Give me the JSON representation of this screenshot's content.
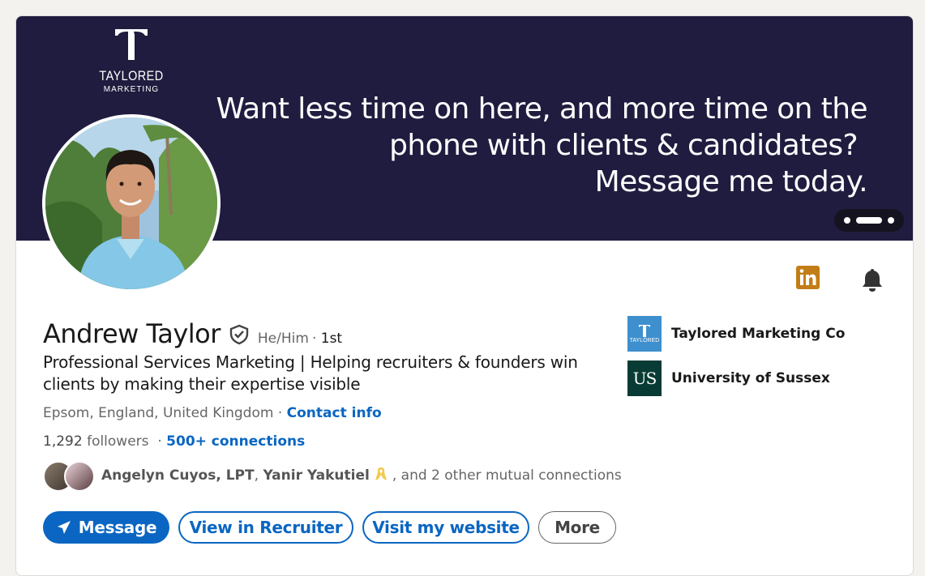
{
  "banner": {
    "brand_name": "TAYLORED",
    "brand_sub": "MARKETING",
    "tagline_lines": [
      "Want less time on here, and more time on the",
      "phone with clients & candidates?",
      "Message me today."
    ],
    "background_color": "#1f1c3f"
  },
  "profile": {
    "name": "Andrew Taylor",
    "pronouns": "He/Him",
    "degree_sep": "·",
    "degree": "1st",
    "headline": "Professional Services Marketing | Helping recruiters & founders win clients by making their expertise visible",
    "location": "Epsom, England, United Kingdom",
    "location_sep": "·",
    "contact_info": "Contact info",
    "followers_count": "1,292",
    "followers_label": "followers",
    "connections_sep": "·",
    "connections": "500+ connections",
    "mutual_names": "Angelyn Cuyos, LPT",
    "mutual_sep": ",",
    "mutual_name_2": "Yanir Yakutiel",
    "mutual_suffix": ", and 2 other mutual connections"
  },
  "actions": {
    "message": "Message",
    "view_recruiter": "View in Recruiter",
    "visit_website": "Visit my website",
    "more": "More"
  },
  "orgs": [
    {
      "name": "Taylored Marketing Co",
      "logo_text": "TAYLORED"
    },
    {
      "name": "University of Sussex",
      "logo_text": "US"
    }
  ],
  "icons": {
    "linkedin": "linkedin-icon",
    "bell": "bell-icon",
    "verify": "verified-shield-icon",
    "send": "send-icon"
  },
  "colors": {
    "accent": "#0a66c2",
    "linkedin_brand": "#c37d16"
  }
}
